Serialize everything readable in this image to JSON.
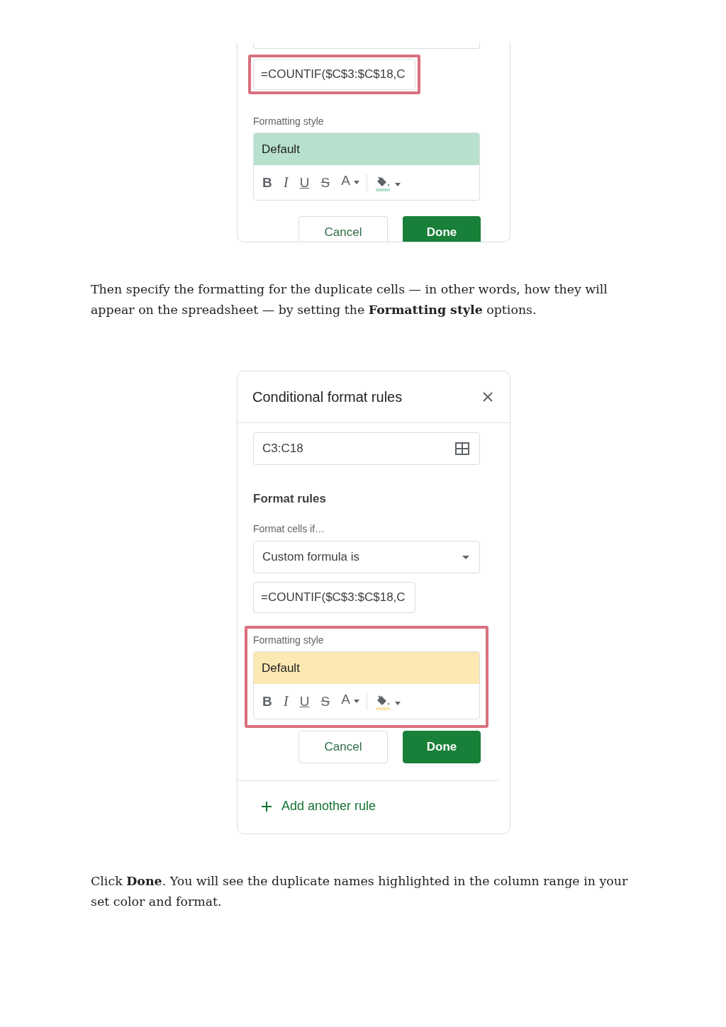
{
  "blocks": [
    {
      "kind": "screenshot",
      "cropped": true,
      "parts": [
        {
          "kind": "empty_field"
        },
        {
          "kind": "formula",
          "value": "=COUNTIF($C$3:$C$18,C",
          "highlighted": true
        },
        {
          "kind": "formatting_style",
          "label": "Formatting style",
          "preview": "Default",
          "color": "#b7e1cd",
          "highlighted": false,
          "toolbar": [
            {
              "kind": "bold",
              "label": "B"
            },
            {
              "kind": "italic",
              "label": "I"
            },
            {
              "kind": "underline",
              "label": "U"
            },
            {
              "kind": "strike",
              "label": "S"
            },
            {
              "kind": "text_color",
              "label": "A"
            },
            {
              "kind": "fill_color"
            }
          ]
        },
        {
          "kind": "buttons",
          "buttons": [
            {
              "label": "Cancel",
              "kind": "secondary"
            },
            {
              "label": "Done",
              "kind": "primary"
            }
          ]
        }
      ]
    },
    {
      "kind": "paragraph",
      "text": "Then specify the formatting for the duplicate cells — in other words, how they will appear on the spreadsheet — by setting the **Formatting style** options."
    },
    {
      "kind": "screenshot",
      "cropped": false,
      "title": "Conditional format rules",
      "parts": [
        {
          "kind": "range",
          "value": "C3:C18"
        },
        {
          "kind": "heading",
          "text": "Format rules"
        },
        {
          "kind": "label",
          "text": "Format cells if…"
        },
        {
          "kind": "dropdown",
          "value": "Custom formula is"
        },
        {
          "kind": "formula",
          "value": "=COUNTIF($C$3:$C$18,C",
          "highlighted": false
        },
        {
          "kind": "formatting_style",
          "label": "Formatting style",
          "preview": "Default",
          "color": "#fce8b2",
          "highlighted": true,
          "toolbar": [
            {
              "kind": "bold",
              "label": "B"
            },
            {
              "kind": "italic",
              "label": "I"
            },
            {
              "kind": "underline",
              "label": "U"
            },
            {
              "kind": "strike",
              "label": "S"
            },
            {
              "kind": "text_color",
              "label": "A"
            },
            {
              "kind": "fill_color"
            }
          ]
        },
        {
          "kind": "buttons",
          "buttons": [
            {
              "label": "Cancel",
              "kind": "secondary"
            },
            {
              "label": "Done",
              "kind": "primary"
            }
          ]
        },
        {
          "kind": "add_rule",
          "label": "Add another rule"
        }
      ]
    },
    {
      "kind": "paragraph",
      "text": "Click **Done**. You will see the duplicate names highlighted in the column range in your set color and format."
    }
  ]
}
